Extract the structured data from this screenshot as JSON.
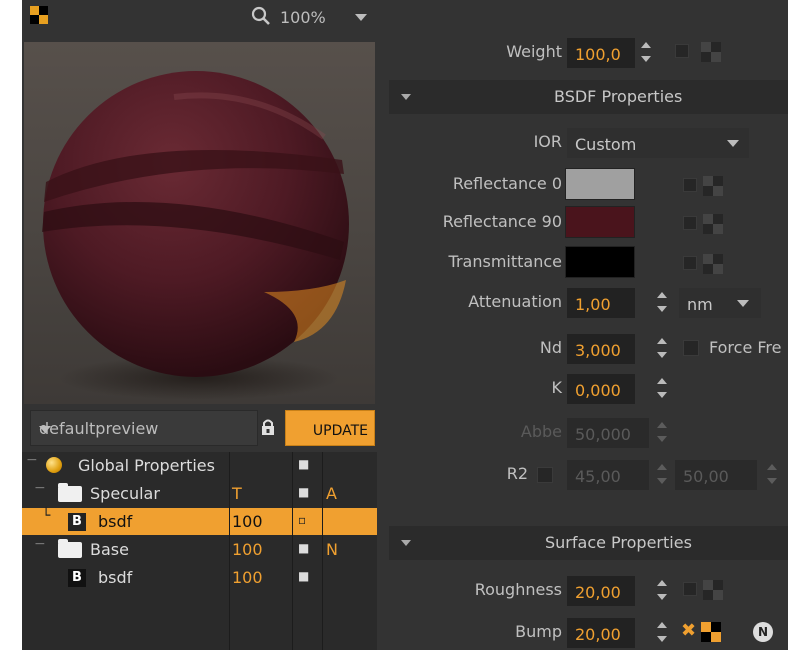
{
  "toolbar": {
    "zoom_label": "100%"
  },
  "preview_panel": {
    "selected_preview": "defaultpreview",
    "update_label": "UPDATE"
  },
  "tree": {
    "rows": [
      {
        "name": "Global Properties",
        "col1": "",
        "col3": ""
      },
      {
        "name": "Specular",
        "col1": "T",
        "col3": "A"
      },
      {
        "name": "bsdf",
        "badge": "B",
        "col1": "100",
        "col3": ""
      },
      {
        "name": "Base",
        "col1": "100",
        "col3": "N"
      },
      {
        "name": "bsdf",
        "badge": "B",
        "col1": "100",
        "col3": ""
      }
    ]
  },
  "properties": {
    "weight": {
      "label": "Weight",
      "value": "100,0"
    },
    "bsdf_section": "BSDF Properties",
    "ior": {
      "label": "IOR",
      "value": "Custom"
    },
    "reflectance0": {
      "label": "Reflectance 0",
      "color": "#a0a0a0"
    },
    "reflectance90": {
      "label": "Reflectance 90",
      "color": "#4a141c"
    },
    "transmittance": {
      "label": "Transmittance",
      "color": "#000000"
    },
    "attenuation": {
      "label": "Attenuation",
      "value": "1,00",
      "unit": "nm"
    },
    "nd": {
      "label": "Nd",
      "value": "3,000",
      "force_label": "Force Fre"
    },
    "k": {
      "label": "K",
      "value": "0,000"
    },
    "abbe": {
      "label": "Abbe",
      "value": "50,000"
    },
    "r2": {
      "label": "R2",
      "value1": "45,00",
      "value2": "50,00"
    },
    "surface_section": "Surface Properties",
    "roughness": {
      "label": "Roughness",
      "value": "20,00"
    },
    "bump": {
      "label": "Bump",
      "value": "20,00"
    }
  },
  "colors": {
    "accent": "#f0a030",
    "panel": "#333333",
    "field": "#222222"
  }
}
